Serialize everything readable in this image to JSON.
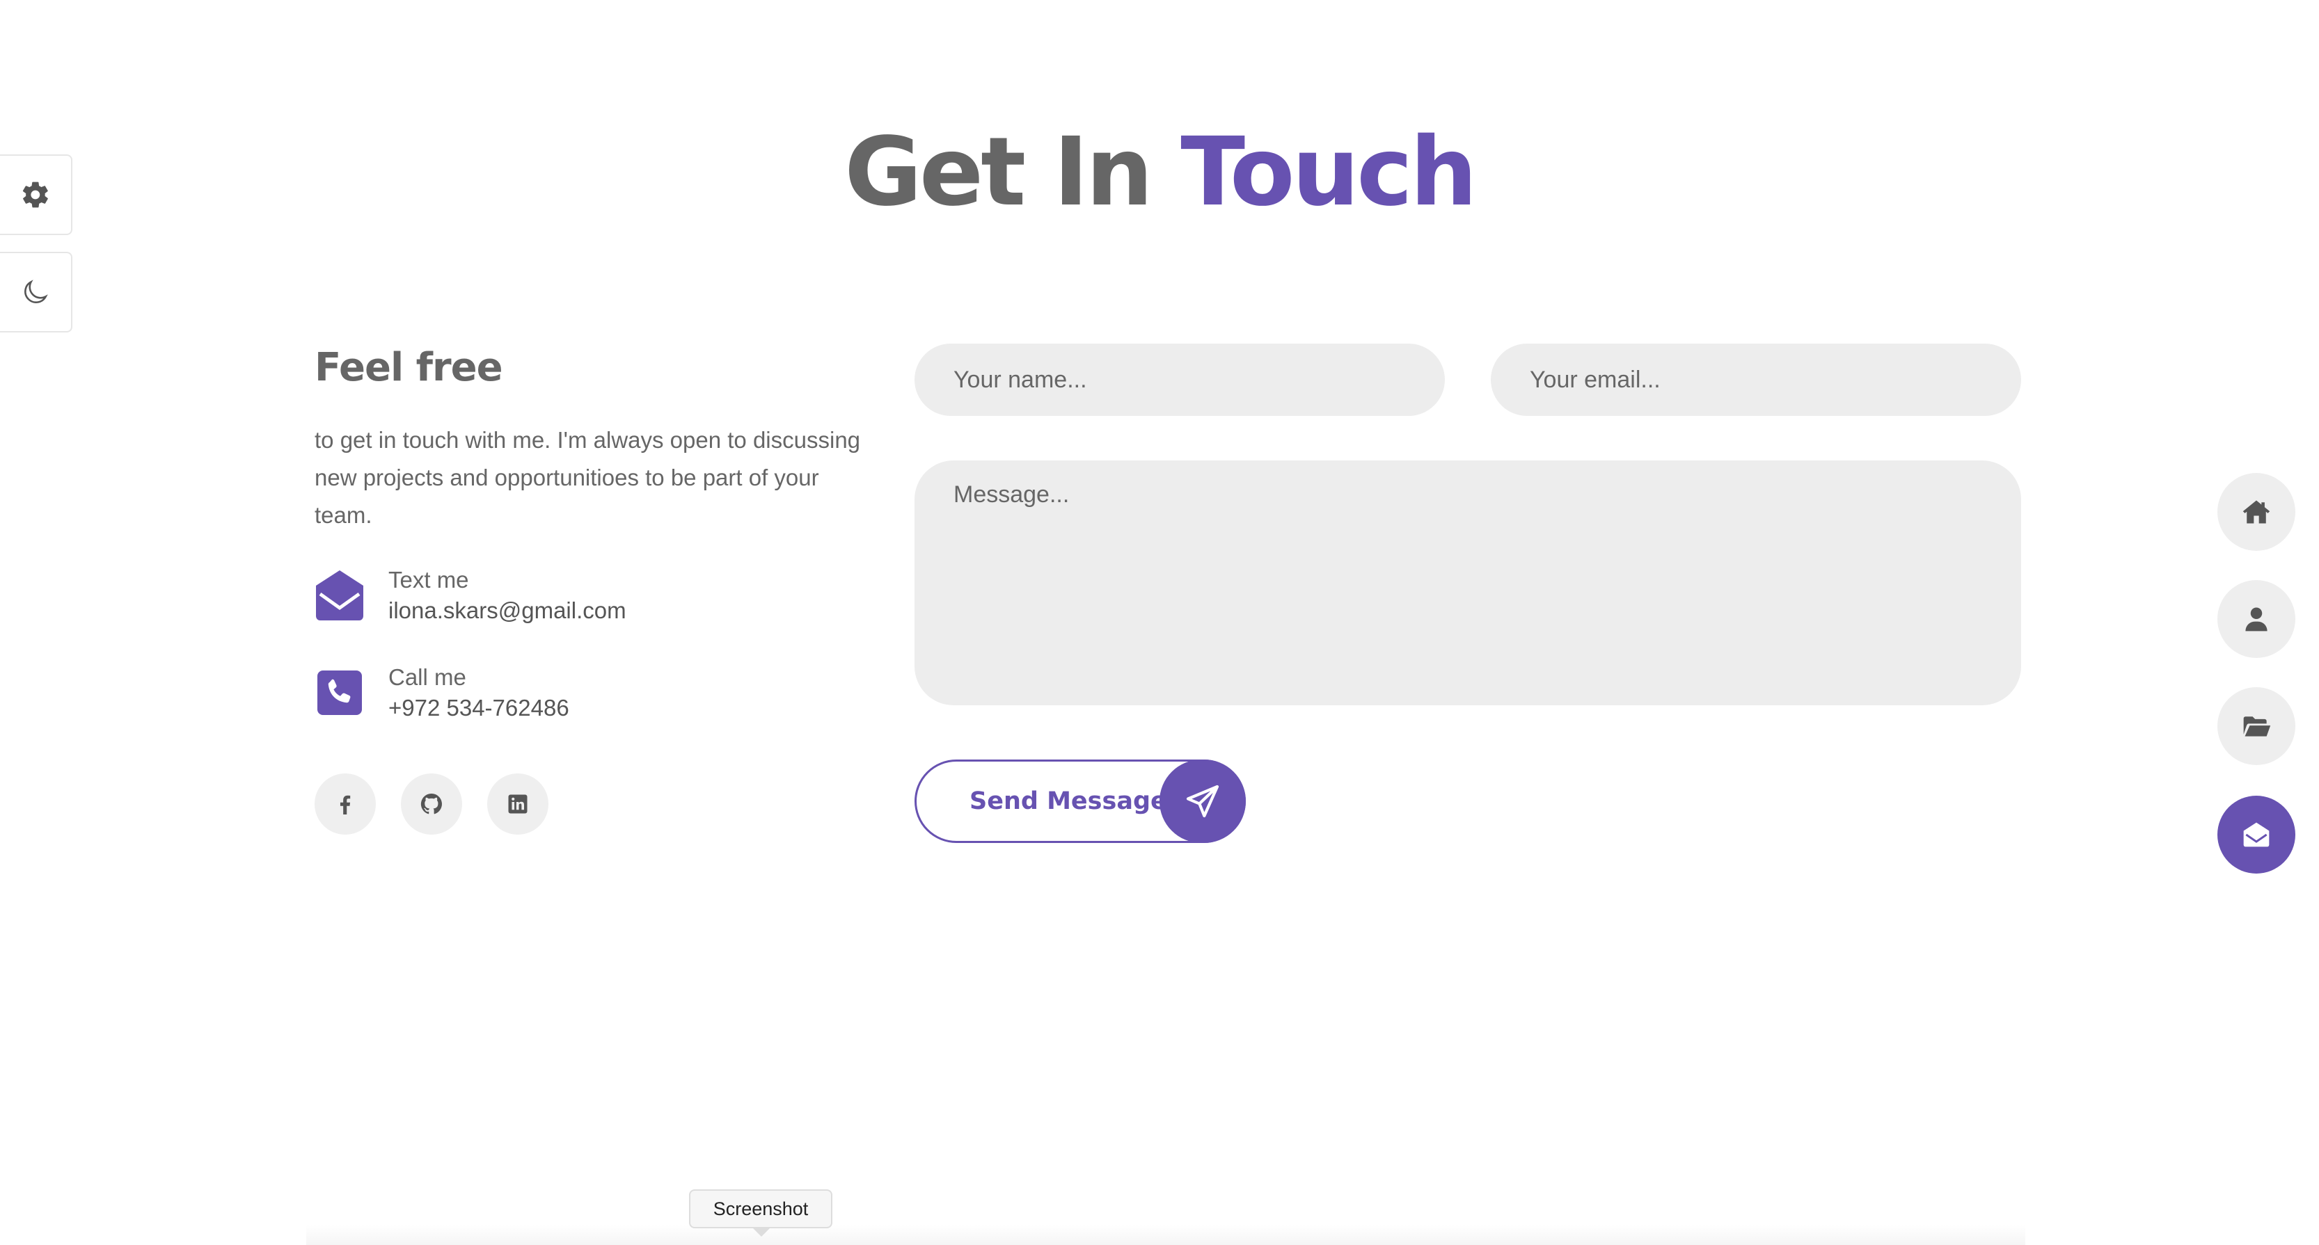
{
  "title": {
    "part1": "Get In",
    "part2": "Touch"
  },
  "intro": {
    "heading": "Feel free",
    "text": "to get in touch with me. I'm always open to discussing new projects and opportunitioes to be part of your team."
  },
  "contacts": [
    {
      "label": "Text me",
      "value": "ilona.skars@gmail.com",
      "icon": "envelope-open-icon"
    },
    {
      "label": "Call me",
      "value": "+972 534-762486",
      "icon": "phone-icon"
    }
  ],
  "social": [
    {
      "icon": "facebook-icon"
    },
    {
      "icon": "github-icon"
    },
    {
      "icon": "linkedin-icon"
    }
  ],
  "form": {
    "name_placeholder": "Your name...",
    "email_placeholder": "Your email...",
    "message_placeholder": "Message...",
    "send_label": "Send Message"
  },
  "side_panel": [
    {
      "icon": "gear-icon"
    },
    {
      "icon": "moon-icon"
    }
  ],
  "nav": [
    {
      "icon": "home-icon"
    },
    {
      "icon": "user-icon"
    },
    {
      "icon": "folder-open-icon"
    },
    {
      "icon": "envelope-open-icon",
      "active": true
    }
  ],
  "tooltip": {
    "text": "Screenshot"
  },
  "colors": {
    "accent": "#6752b1",
    "text": "#666666",
    "input_bg": "#ededed"
  }
}
